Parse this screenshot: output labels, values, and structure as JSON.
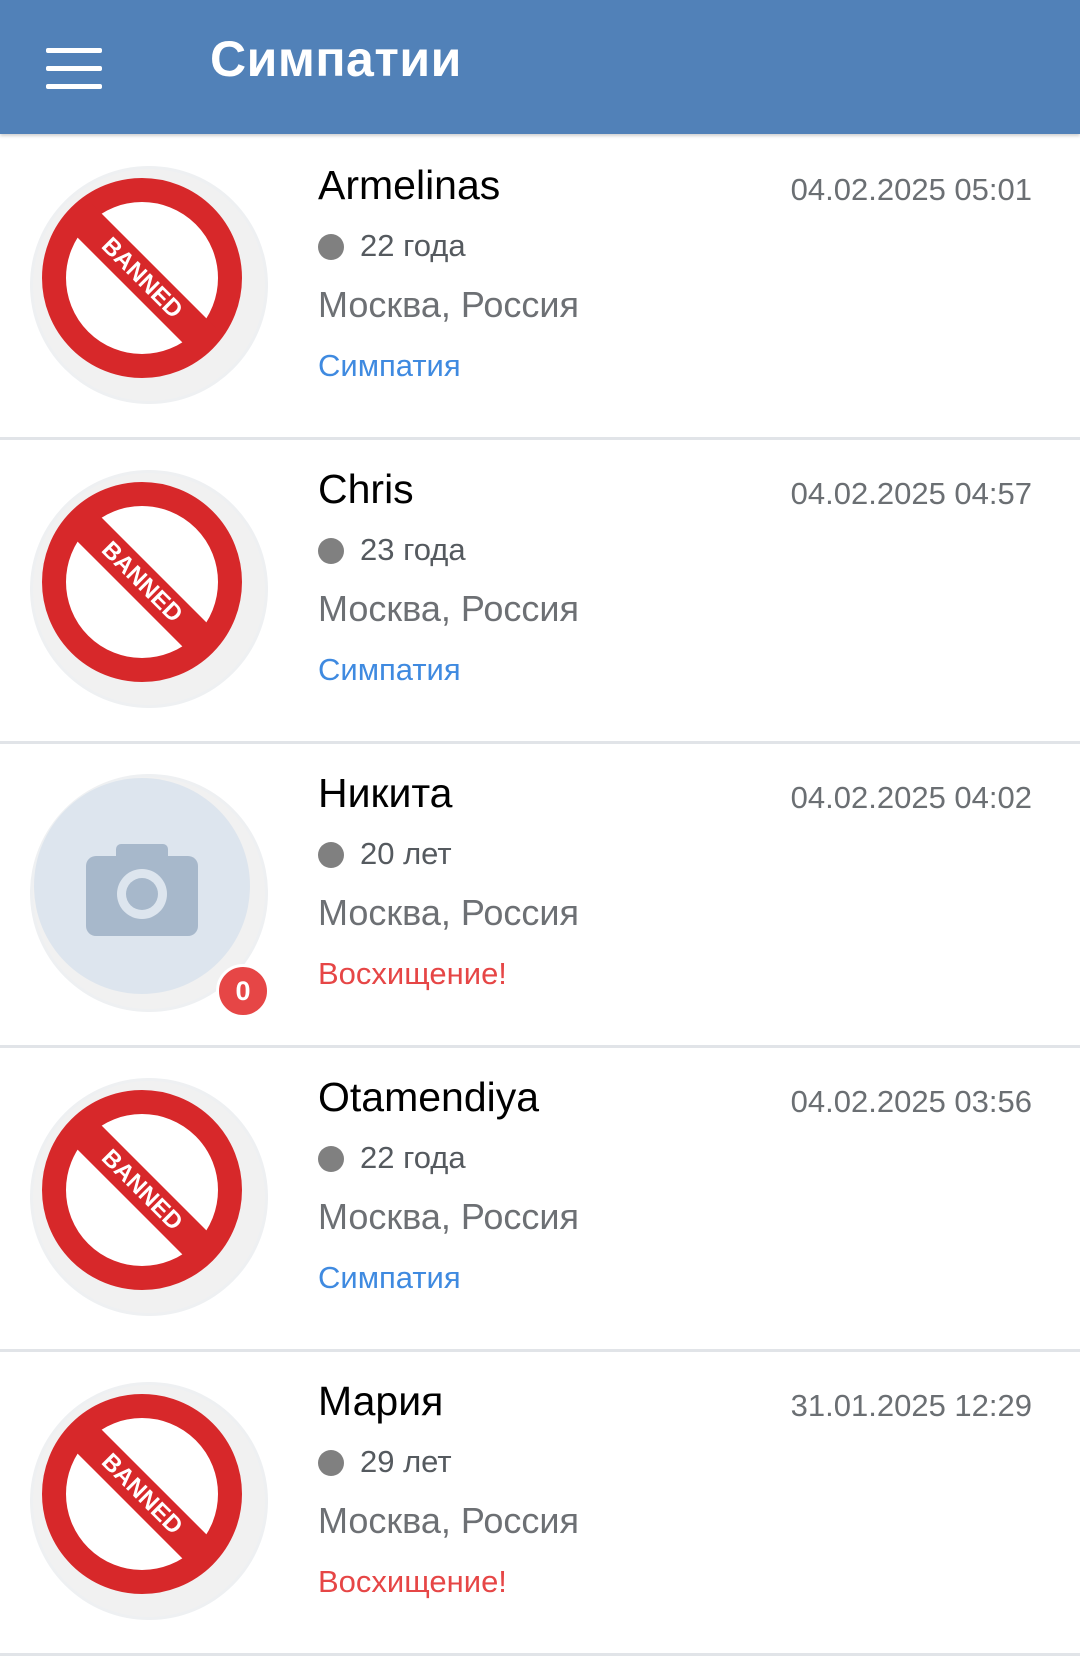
{
  "header": {
    "menu_icon": "hamburger-menu-icon",
    "title": "Симпатии",
    "background_color": "#5181b8"
  },
  "colors": {
    "sympathy": "#3f8ae0",
    "admiration": "#e64646",
    "badge": "#e64646"
  },
  "items": [
    {
      "name": "Armelinas",
      "date": "04.02.2025 05:01",
      "age": "22 года",
      "city": "Москва, Россия",
      "kind": "Симпатия",
      "kind_type": "sympathy",
      "avatar": "banned-icon",
      "banned_label": "BANNED"
    },
    {
      "name": "Chris",
      "date": "04.02.2025 04:57",
      "age": "23 года",
      "city": "Москва, Россия",
      "kind": "Симпатия",
      "kind_type": "sympathy",
      "avatar": "banned-icon",
      "banned_label": "BANNED"
    },
    {
      "name": "Никита",
      "date": "04.02.2025 04:02",
      "age": "20 лет",
      "city": "Москва, Россия",
      "kind": "Восхищение!",
      "kind_type": "admiration",
      "avatar": "camera-placeholder-icon",
      "badge": "0"
    },
    {
      "name": "Otamendiya",
      "date": "04.02.2025 03:56",
      "age": "22 года",
      "city": "Москва, Россия",
      "kind": "Симпатия",
      "kind_type": "sympathy",
      "avatar": "banned-icon",
      "banned_label": "BANNED"
    },
    {
      "name": "Мария",
      "date": "31.01.2025 12:29",
      "age": "29 лет",
      "city": "Москва, Россия",
      "kind": "Восхищение!",
      "kind_type": "admiration",
      "avatar": "banned-icon",
      "banned_label": "BANNED"
    }
  ]
}
